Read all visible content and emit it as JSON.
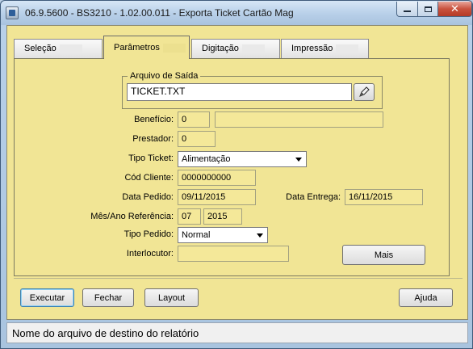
{
  "window": {
    "title": "06.9.5600 - BS3210 - 1.02.00.011 - Exporta Ticket Cartão Mag",
    "close_glyph": "✕"
  },
  "tabs": [
    {
      "label": "Seleção"
    },
    {
      "label": "Parâmetros"
    },
    {
      "label": "Digitação"
    },
    {
      "label": "Impressão"
    }
  ],
  "output_file": {
    "legend": "Arquivo de Saída",
    "value": "TICKET.TXT",
    "browse_icon": "pen-browse-icon"
  },
  "form": {
    "beneficio": {
      "label": "Benefício:",
      "value": "0",
      "description": ""
    },
    "prestador": {
      "label": "Prestador:",
      "value": "0"
    },
    "tipo_ticket": {
      "label": "Tipo Ticket:",
      "value": "Alimentação"
    },
    "cod_cliente": {
      "label": "Cód Cliente:",
      "value": "0000000000"
    },
    "data_pedido": {
      "label": "Data Pedido:",
      "value": "09/11/2015"
    },
    "data_entrega": {
      "label": "Data Entrega:",
      "value": "16/11/2015"
    },
    "mes_ano_ref": {
      "label": "Mês/Ano Referência:",
      "month": "07",
      "year": "2015"
    },
    "tipo_pedido": {
      "label": "Tipo Pedido:",
      "value": "Normal"
    },
    "interlocutor": {
      "label": "Interlocutor:",
      "value": ""
    },
    "mais_label": "Mais"
  },
  "actions": {
    "executar": "Executar",
    "fechar": "Fechar",
    "layout": "Layout",
    "ajuda": "Ajuda"
  },
  "status": {
    "text": "Nome do arquivo de destino do relatório"
  }
}
